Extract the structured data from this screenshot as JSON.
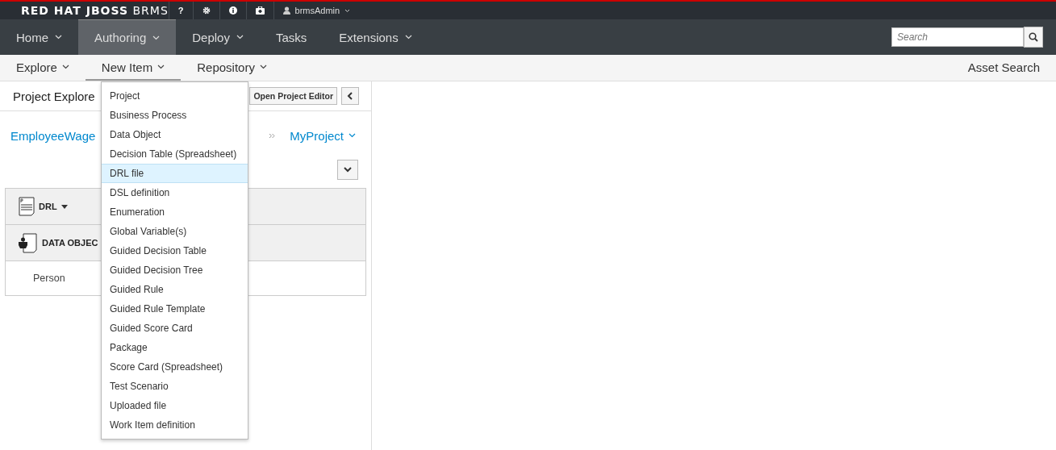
{
  "brand": "**RED HAT JBOSS** BRMS",
  "utility": {
    "help": "?",
    "user": "brmsAdmin"
  },
  "nav": [
    {
      "label": "Home",
      "has_menu": true,
      "selected": false
    },
    {
      "label": "Authoring",
      "has_menu": true,
      "selected": true
    },
    {
      "label": "Deploy",
      "has_menu": true,
      "selected": false
    },
    {
      "label": "Tasks",
      "has_menu": false,
      "selected": false
    },
    {
      "label": "Extensions",
      "has_menu": true,
      "selected": false
    }
  ],
  "search": {
    "placeholder": "Search"
  },
  "subnav": [
    {
      "label": "Explore",
      "selected": false
    },
    {
      "label": "New Item",
      "selected": true
    },
    {
      "label": "Repository",
      "selected": false
    }
  ],
  "asset_search": "Asset Search",
  "panel": {
    "title": "Project Explore",
    "open_button": "Open Project Editor",
    "breadcrumb": [
      "EmployeeWage",
      "MyProject"
    ],
    "groups": [
      {
        "kind": "drl",
        "label": "DRL"
      },
      {
        "kind": "data_object",
        "label": "DATA OBJEC",
        "items": [
          "Person"
        ]
      }
    ]
  },
  "menu": [
    {
      "label": "Project",
      "selected": false
    },
    {
      "label": "Business Process",
      "selected": false
    },
    {
      "label": "Data Object",
      "selected": false
    },
    {
      "label": "Decision Table (Spreadsheet)",
      "selected": false
    },
    {
      "label": "DRL file",
      "selected": true
    },
    {
      "label": "DSL definition",
      "selected": false
    },
    {
      "label": "Enumeration",
      "selected": false
    },
    {
      "label": "Global Variable(s)",
      "selected": false
    },
    {
      "label": "Guided Decision Table",
      "selected": false
    },
    {
      "label": "Guided Decision Tree",
      "selected": false
    },
    {
      "label": "Guided Rule",
      "selected": false
    },
    {
      "label": "Guided Rule Template",
      "selected": false
    },
    {
      "label": "Guided Score Card",
      "selected": false
    },
    {
      "label": "Package",
      "selected": false
    },
    {
      "label": "Score Card (Spreadsheet)",
      "selected": false
    },
    {
      "label": "Test Scenario",
      "selected": false
    },
    {
      "label": "Uploaded file",
      "selected": false
    },
    {
      "label": "Work Item definition",
      "selected": false
    }
  ]
}
